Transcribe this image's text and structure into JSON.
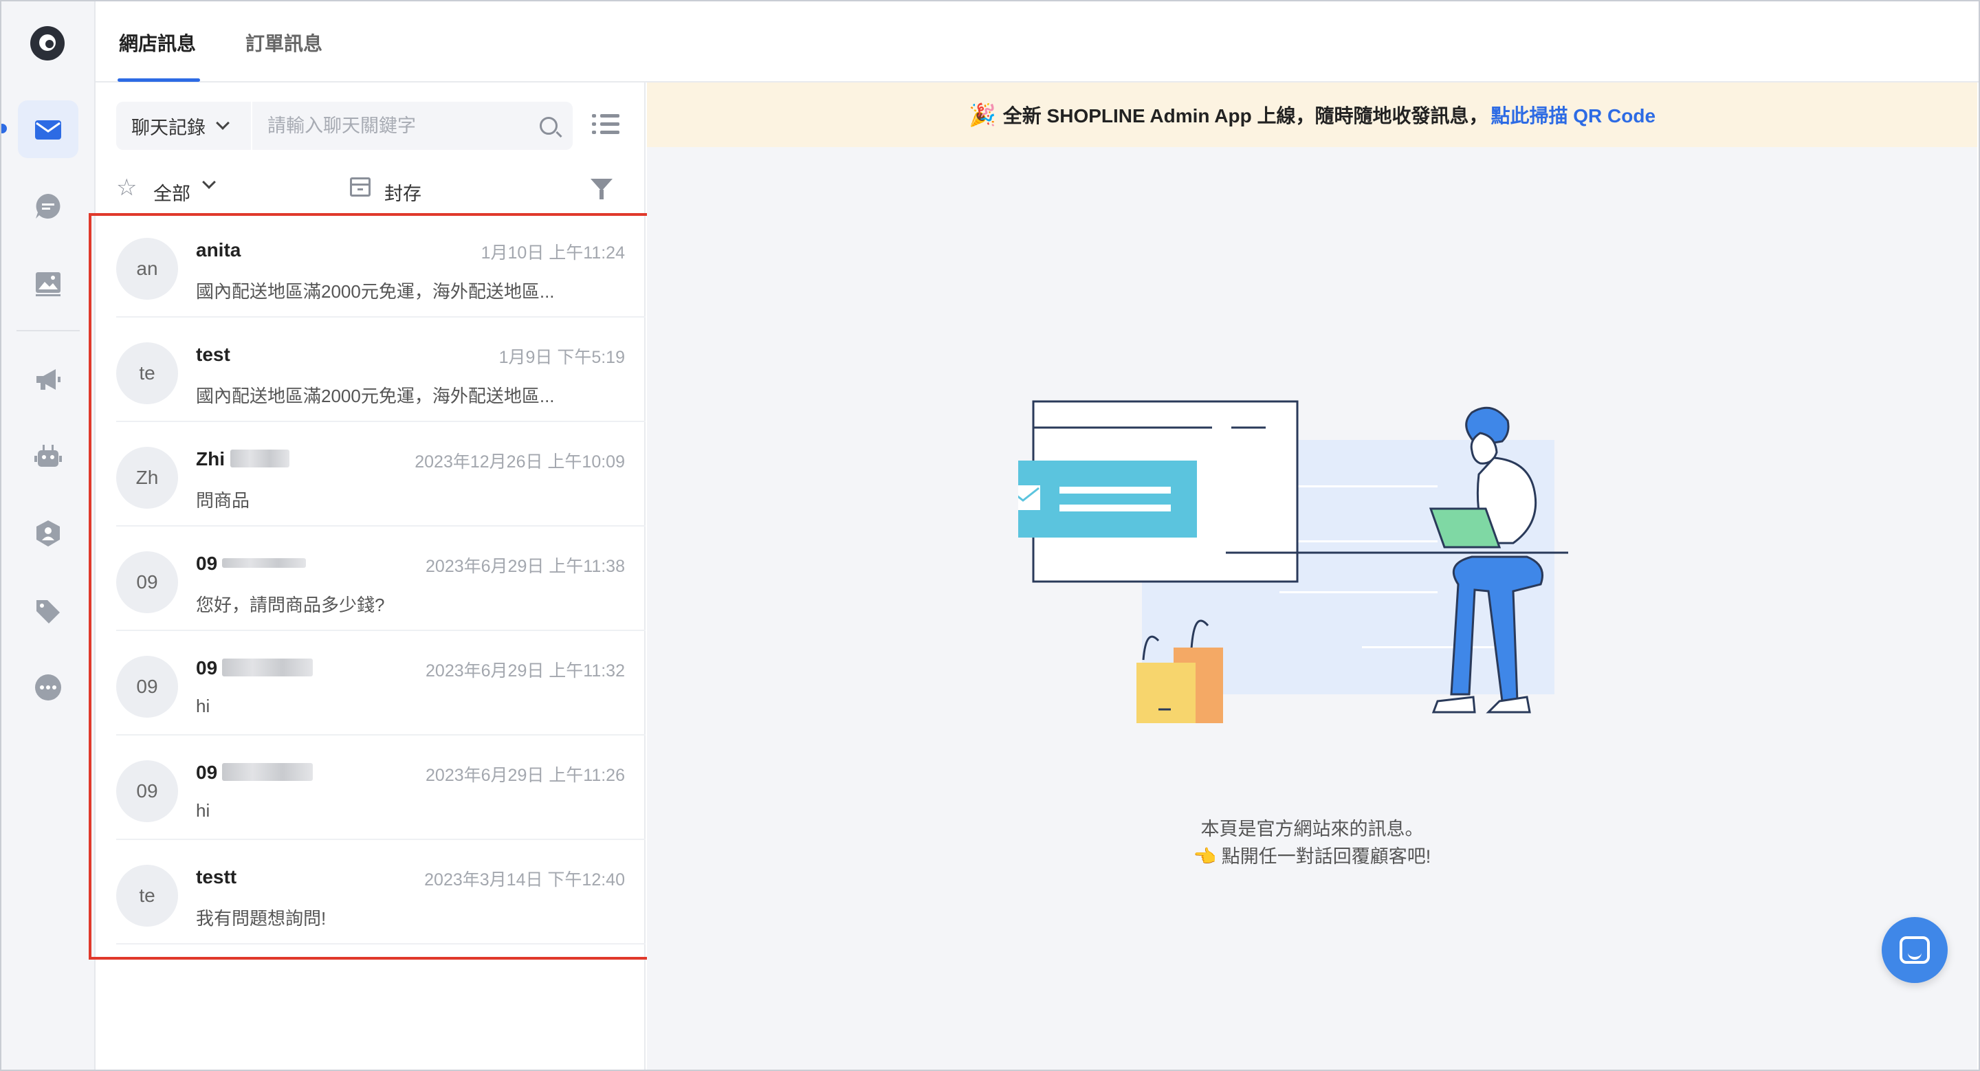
{
  "tabs": [
    {
      "label": "網店訊息",
      "active": true
    },
    {
      "label": "訂單訊息",
      "active": false
    }
  ],
  "search": {
    "scope": "聊天記錄",
    "placeholder": "請輸入聊天關鍵字",
    "value": ""
  },
  "filters": {
    "all_label": "全部",
    "archive_label": "封存"
  },
  "conversations": [
    {
      "avatar": "an",
      "name": "anita",
      "time": "1月10日 上午11:24",
      "preview": "國內配送地區滿2000元免運，海外配送地區..."
    },
    {
      "avatar": "te",
      "name": "test",
      "time": "1月9日 下午5:19",
      "preview": "國內配送地區滿2000元免運，海外配送地區..."
    },
    {
      "avatar": "Zh",
      "name": "Zhi",
      "time": "2023年12月26日 上午10:09",
      "preview": "問商品"
    },
    {
      "avatar": "09",
      "name": "09",
      "time": "2023年6月29日 上午11:38",
      "preview": "您好，請問商品多少錢?"
    },
    {
      "avatar": "09",
      "name": "09",
      "time": "2023年6月29日 上午11:32",
      "preview": "hi"
    },
    {
      "avatar": "09",
      "name": "09",
      "time": "2023年6月29日 上午11:26",
      "preview": "hi"
    },
    {
      "avatar": "te",
      "name": "testt",
      "time": "2023年3月14日 下午12:40",
      "preview": "我有問題想詢問!"
    }
  ],
  "banner": {
    "icon": "party-popper-icon",
    "text": "全新 SHOPLINE Admin App 上線，隨時隨地收發訊息，",
    "link": "點此掃描 QR Code"
  },
  "empty_state": {
    "line1": "本頁是官方網站來的訊息。",
    "line2": "👈 點開任一對話回覆顧客吧!"
  },
  "colors": {
    "accent": "#2d6be4",
    "highlight": "#e0392b",
    "banner_bg": "#fcf3e1",
    "illustration_teal": "#5bc4de",
    "illustration_blue": "#3f87e8"
  }
}
